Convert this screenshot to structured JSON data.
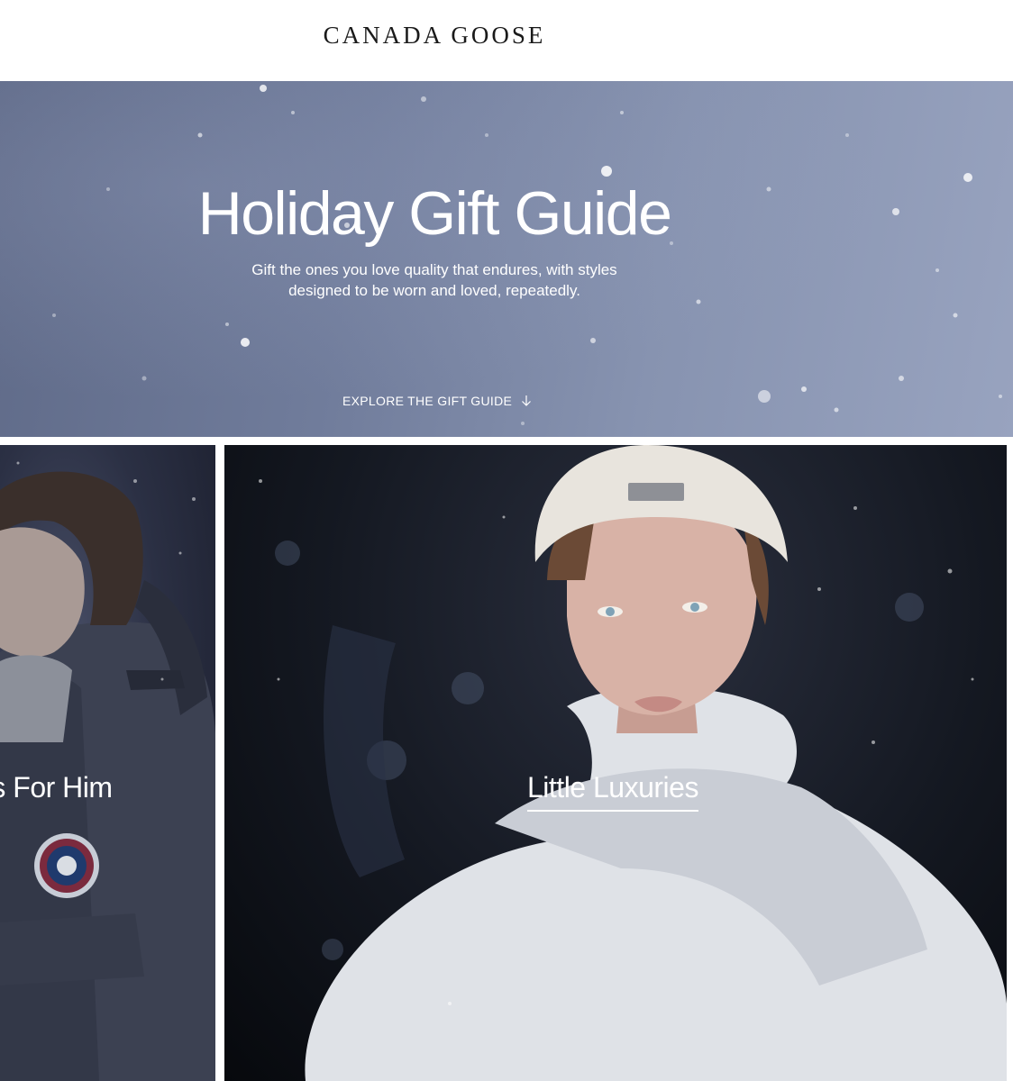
{
  "header": {
    "logo_text": "CANADA GOOSE"
  },
  "hero": {
    "title": "Holiday Gift Guide",
    "subtitle_line1": "Gift the ones you love quality that endures, with styles",
    "subtitle_line2": "designed to be worn and loved, repeatedly.",
    "cta_label": "EXPLORE THE GIFT GUIDE",
    "cta_icon": "arrow-down-icon"
  },
  "cards": [
    {
      "label": "ts For Him"
    },
    {
      "label": "Little Luxuries"
    }
  ],
  "colors": {
    "hero_bg": "#707c9b",
    "card_dark": "#141821",
    "text_on_image": "#ffffff",
    "header_bg": "#ffffff"
  }
}
